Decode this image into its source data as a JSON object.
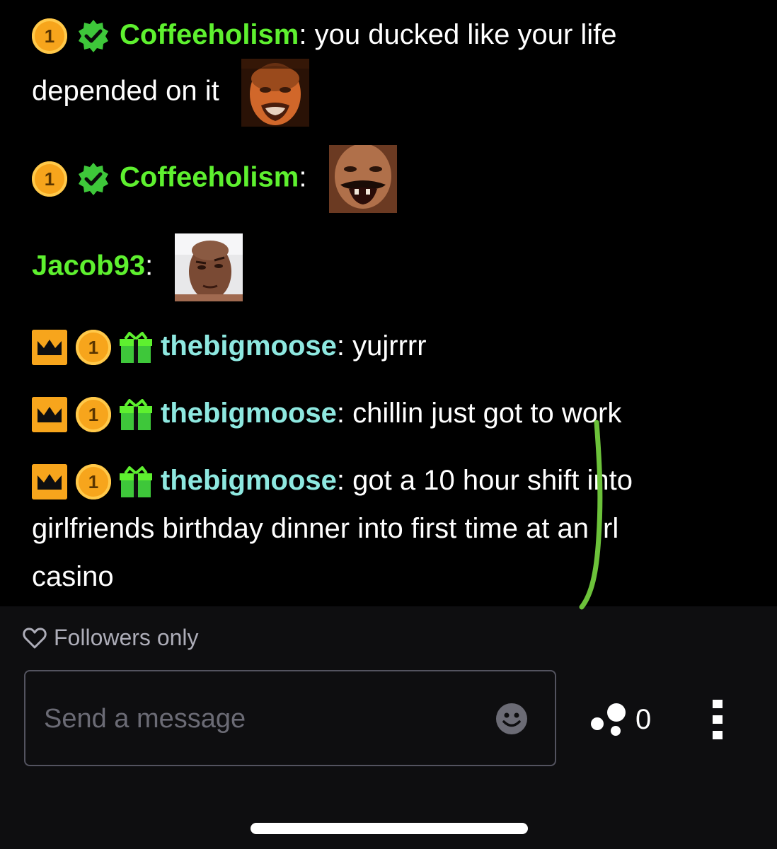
{
  "messages": [
    {
      "badges": [
        "coin-badge",
        "verified-badge"
      ],
      "badge_count": "1",
      "username": "Coffeeholism",
      "separator": ":",
      "text": "you ducked like your life depended on it",
      "emote": "crying-man-emote"
    },
    {
      "badges": [
        "coin-badge",
        "verified-badge"
      ],
      "badge_count": "1",
      "username": "Coffeeholism",
      "separator": ":",
      "text": "",
      "emote": "laughing-man-emote"
    },
    {
      "badges": [],
      "username": "Jacob93",
      "separator": ":",
      "text": "",
      "emote": "rock-eyebrow-emote"
    },
    {
      "badges": [
        "crown-badge",
        "coin-badge",
        "gift-badge"
      ],
      "badge_count": "1",
      "username": "thebigmoose",
      "separator": ":",
      "text": "yujrrrr"
    },
    {
      "badges": [
        "crown-badge",
        "coin-badge",
        "gift-badge"
      ],
      "badge_count": "1",
      "username": "thebigmoose",
      "separator": ":",
      "text": "chillin just got to work"
    },
    {
      "badges": [
        "crown-badge",
        "coin-badge",
        "gift-badge"
      ],
      "badge_count": "1",
      "username": "thebigmoose",
      "separator": ":",
      "text_line1": "got a 10 hour shift into",
      "text_line2": "girlfriends birthday dinner into first time at an irl",
      "text_line3": "casino"
    }
  ],
  "footer": {
    "mode_label": "Followers only",
    "input_placeholder": "Send a message",
    "points_count": "0"
  },
  "colors": {
    "username_green": "#5ef02f",
    "username_teal": "#8ee8e0",
    "badge_gold": "#f7a51c",
    "scribble": "#6cc23a"
  }
}
